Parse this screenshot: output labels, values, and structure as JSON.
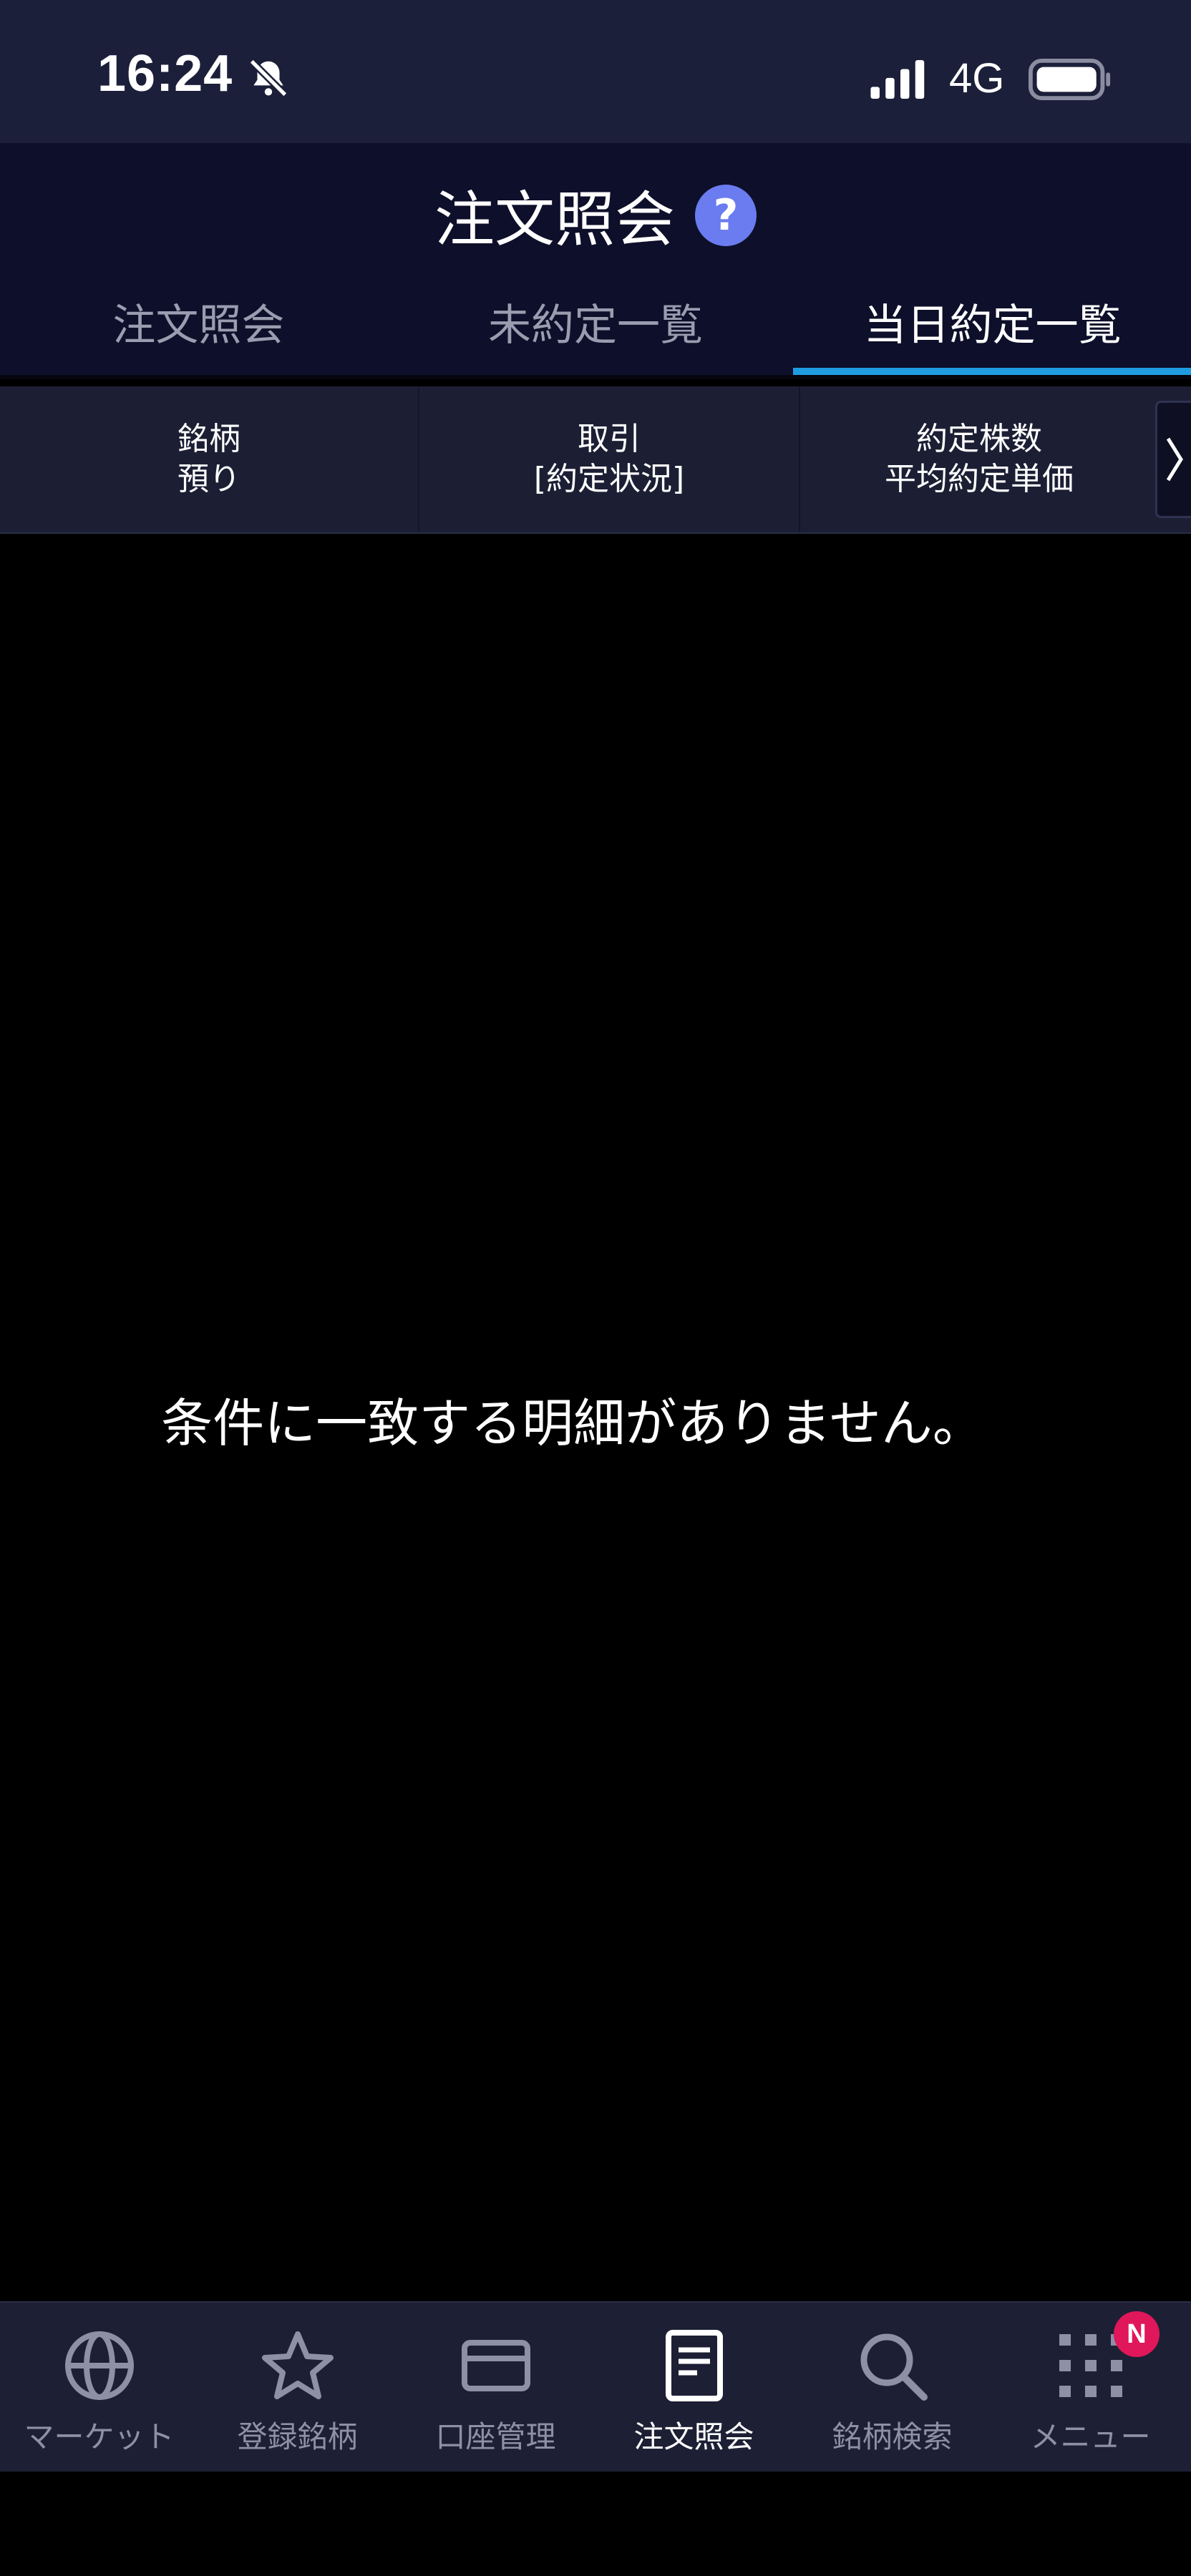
{
  "status_bar": {
    "time": "16:24",
    "network": "4G"
  },
  "header": {
    "title": "注文照会",
    "help_symbol": "?",
    "tabs": [
      {
        "label": "注文照会",
        "active": false
      },
      {
        "label": "未約定一覧",
        "active": false
      },
      {
        "label": "当日約定一覧",
        "active": true
      }
    ]
  },
  "columns": [
    {
      "line1": "銘柄",
      "line2": "預り"
    },
    {
      "line1": "取引",
      "line2": "[約定状況]"
    },
    {
      "line1": "約定株数",
      "line2": "平均約定単価"
    }
  ],
  "empty_message": "条件に一致する明細がありません。",
  "bottom_nav": {
    "items": [
      {
        "label": "マーケット",
        "icon": "globe-icon",
        "active": false
      },
      {
        "label": "登録銘柄",
        "icon": "star-icon",
        "active": false
      },
      {
        "label": "口座管理",
        "icon": "card-icon",
        "active": false
      },
      {
        "label": "注文照会",
        "icon": "document-icon",
        "active": true
      },
      {
        "label": "銘柄検索",
        "icon": "search-icon",
        "active": false
      },
      {
        "label": "メニュー",
        "icon": "grid-icon",
        "active": false
      }
    ],
    "menu_badge": "N"
  },
  "colors": {
    "accent": "#1f9ce0",
    "help": "#6a7cf0",
    "badge": "#e0175a"
  }
}
